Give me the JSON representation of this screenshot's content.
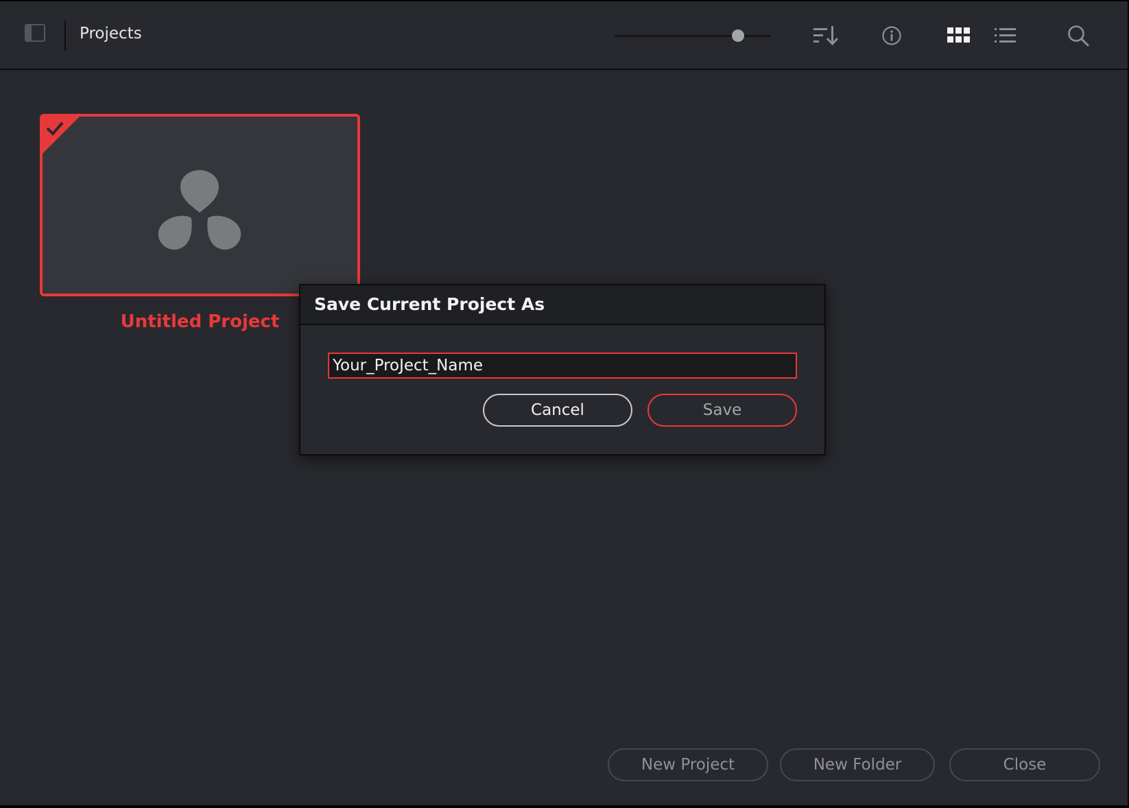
{
  "header": {
    "title": "Projects",
    "zoom_slider_value": 0.79
  },
  "project": {
    "name": "Untitled Project",
    "selected": true
  },
  "dialog": {
    "title": "Save Current Project As",
    "input_value": "Your_ProJect_Name",
    "cancel_label": "Cancel",
    "save_label": "Save"
  },
  "footer": {
    "new_project_label": "New Project",
    "new_folder_label": "New Folder",
    "close_label": "Close"
  },
  "colors": {
    "accent": "#e8393a",
    "background": "#28292e",
    "icon": "#8e8f94"
  },
  "icons": {
    "panel_toggle": "sidebar-toggle-icon",
    "sort": "sort-descending-icon",
    "info": "info-icon",
    "grid_view": "grid-view-icon",
    "list_view": "list-view-icon",
    "search": "search-icon",
    "checkmark": "checkmark-icon",
    "project_logo": "resolve-logo-icon"
  }
}
